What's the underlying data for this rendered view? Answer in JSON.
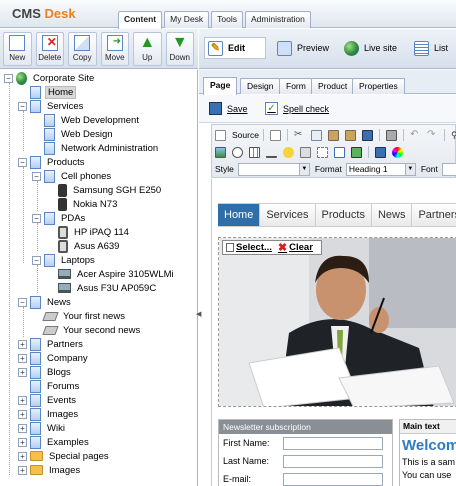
{
  "app": {
    "logo_prefix": "CMS",
    "logo_suffix": "Desk",
    "accent_color": "#e8821e"
  },
  "main_tabs": [
    {
      "label": "Content",
      "active": true
    },
    {
      "label": "My Desk",
      "active": false
    },
    {
      "label": "Tools",
      "active": false
    },
    {
      "label": "Administration",
      "active": false
    }
  ],
  "left_toolbar": {
    "new": "New",
    "delete": "Delete",
    "copy": "Copy",
    "move": "Move",
    "up": "Up",
    "down": "Down"
  },
  "tree": {
    "root": "Corporate Site",
    "home": "Home",
    "services": "Services",
    "web_development": "Web Development",
    "web_design": "Web Design",
    "network_administration": "Network Administration",
    "products": "Products",
    "cell_phones": "Cell phones",
    "samsung": "Samsung SGH E250",
    "nokia": "Nokia N73",
    "pdas": "PDAs",
    "hp_ipaq": "HP iPAQ 114",
    "asus_a639": "Asus A639",
    "laptops": "Laptops",
    "acer": "Acer Aspire 3105WLMi",
    "asus_f3u": "Asus F3U AP059C",
    "news": "News",
    "first_news": "Your first news",
    "second_news": "Your second news",
    "partners": "Partners",
    "company": "Company",
    "blogs": "Blogs",
    "forums": "Forums",
    "events": "Events",
    "images": "Images",
    "wiki": "Wiki",
    "examples": "Examples",
    "special_pages": "Special pages",
    "images_folder": "Images"
  },
  "view_modes": {
    "edit": "Edit",
    "preview": "Preview",
    "live_site": "Live site",
    "list": "List"
  },
  "sub_tabs": [
    {
      "label": "Page",
      "active": true
    },
    {
      "label": "Design",
      "active": false
    },
    {
      "label": "Form",
      "active": false
    },
    {
      "label": "Product",
      "active": false
    },
    {
      "label": "Properties",
      "active": false
    }
  ],
  "actions": {
    "save": "Save",
    "spell_check": "Spell check"
  },
  "editor": {
    "source_label": "Source",
    "style_label": "Style",
    "style_value": "",
    "format_label": "Format",
    "format_value": "Heading 1",
    "font_label": "Font"
  },
  "site": {
    "nav": [
      "Home",
      "Services",
      "Products",
      "News",
      "Partners"
    ],
    "nav_active": "Home",
    "webpart_select": "Select...",
    "webpart_clear": "Clear",
    "newsletter_title": "Newsletter subscription",
    "first_name_label": "First Name:",
    "last_name_label": "Last Name:",
    "email_label": "E-mail:",
    "main_text_title": "Main text",
    "welcome": "Welcome",
    "body_line1": "This is a sam",
    "body_line2": "You can use"
  }
}
